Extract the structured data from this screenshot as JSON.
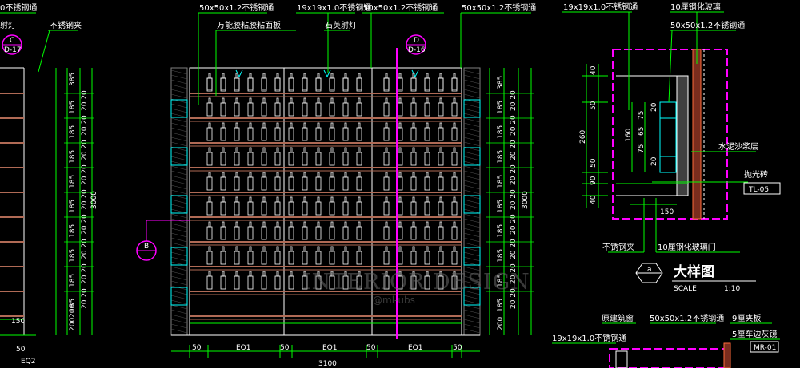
{
  "colors": {
    "background": "#000000",
    "cyan": "#00ffff",
    "green": "#00ff00",
    "magenta": "#ff00ff",
    "white": "#ffffff",
    "yellow": "#ffff00",
    "shelf": "#b06a55",
    "grey": "#808080"
  },
  "callouts": {
    "top_left_material": "0不锈钢通",
    "stainless_clip": "不锈钢夹",
    "spot_lamp_left": "射灯",
    "tube_50_a": "50x50x1.2不锈钢通",
    "tube_19": "19x19x1.0不锈钢通",
    "tube_50_b": "50x50x1.2不锈钢通",
    "tube_50_c": "50x50x1.2不锈钢通",
    "glue_lamp": "万能胶粘胶粘面板",
    "quartz_lamp": "石英射灯",
    "detail_tube_19": "19x19x1.0不锈钢通",
    "tempered_glass": "10厘钢化玻璃",
    "detail_tube_50": "50x50x1.2不锈钢通",
    "cement_mortar": "水泥沙浆层",
    "polished_tile": "抛光砖",
    "tile_code": "TL-05",
    "detail_clip": "不锈钢夹",
    "glass_door": "10厘钢化玻璃门",
    "bottom_curtain": "原建筑窗",
    "bottom_tube_50": "50x50x1.2不锈钢通",
    "bottom_board": "9厘夹板",
    "bottom_mirror": "5厘车边灰镜",
    "mirror_code": "MR-01",
    "bottom_tube_19": "19x19x1.0不锈钢通"
  },
  "section_markers": {
    "c": {
      "top": "C",
      "bottom": "D-17"
    },
    "d": {
      "top": "D",
      "bottom": "D-16"
    },
    "b": {
      "top": "B",
      "bottom": ""
    }
  },
  "detail_title": {
    "symbol": "a",
    "title": "大样图",
    "scale_label": "SCALE",
    "scale_value": "1:10"
  },
  "left_dims": {
    "top": "385",
    "pair": "20 20",
    "repeat": "185",
    "total": "3000",
    "bottom_a": "200",
    "bottom_b": "200",
    "width_150": "150"
  },
  "right_dims": {
    "top": "385",
    "total": "3000",
    "bottom": "200"
  },
  "bottom_dims": {
    "offset": "50",
    "eq": "EQ1",
    "total": "3100",
    "left_total": "EQ2"
  },
  "detail_dims": {
    "d40a": "40",
    "d50a": "50",
    "d260": "260",
    "d50b": "50",
    "d90": "90",
    "d40b": "40",
    "d160": "160",
    "d75a": "75",
    "d65": "65",
    "d75b": "75",
    "d20a": "20",
    "d20b": "20",
    "d150": "150"
  },
  "watermark": {
    "main": "INTERIOR DESIGN",
    "sub": "@ml-ubs"
  }
}
